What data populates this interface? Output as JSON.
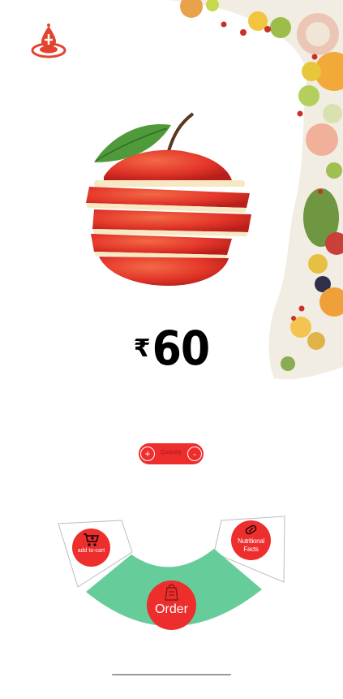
{
  "product": {
    "name": "apple",
    "currency_symbol": "₹",
    "price": "60"
  },
  "quantity": {
    "increment_label": "+",
    "label": "Quantity",
    "decrement_label": "-"
  },
  "actions": {
    "add_to_cart": "add to-cart",
    "nutritional_facts": "Nutritional Facts",
    "order": "Order"
  },
  "icons": {
    "logo": "water-drop-logo-icon",
    "cart": "cart-icon",
    "nutrition": "pill-icon",
    "order": "food-bag-icon"
  },
  "colors": {
    "accent_red": "#ee2d2d",
    "order_green": "#66cc99",
    "text": "#000000"
  }
}
